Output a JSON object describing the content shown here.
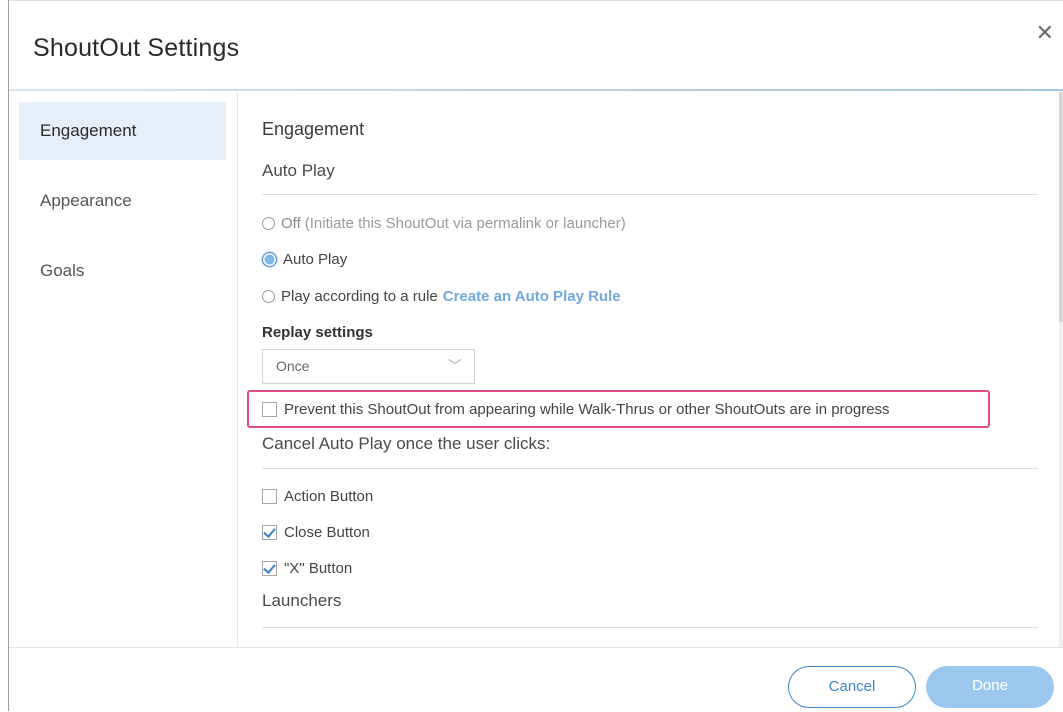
{
  "dialog": {
    "title": "ShoutOut Settings",
    "close_glyph": "✕"
  },
  "sidebar": {
    "items": [
      {
        "label": "Engagement",
        "active": true
      },
      {
        "label": "Appearance",
        "active": false
      },
      {
        "label": "Goals",
        "active": false
      }
    ]
  },
  "content": {
    "section_title": "Engagement",
    "auto_play_title": "Auto Play",
    "options": {
      "off_label": "Off",
      "off_hint": "(Initiate this ShoutOut via permalink or launcher)",
      "auto_play_label": "Auto Play",
      "rule_label": "Play according to a rule",
      "rule_link": "Create an Auto Play Rule",
      "selected": "auto_play"
    },
    "replay": {
      "label": "Replay settings",
      "value": "Once",
      "chevron": "﹀"
    },
    "prevent": {
      "label": "Prevent this ShoutOut from appearing while Walk-Thrus or other ShoutOuts are in progress",
      "checked": false
    },
    "cancel_section": {
      "title": "Cancel Auto Play once the user clicks:",
      "items": [
        {
          "label": "Action Button",
          "checked": false
        },
        {
          "label": "Close Button",
          "checked": true
        },
        {
          "label": "\"X\" Button",
          "checked": true
        }
      ]
    },
    "launchers_title": "Launchers"
  },
  "footer": {
    "cancel_label": "Cancel",
    "done_label": "Done"
  },
  "colors": {
    "accent": "#3c86cc",
    "link": "#6fa9e0",
    "highlight": "#e34b86",
    "done_bg": "#9cc8ef",
    "sidebar_active": "#e6eef9"
  }
}
